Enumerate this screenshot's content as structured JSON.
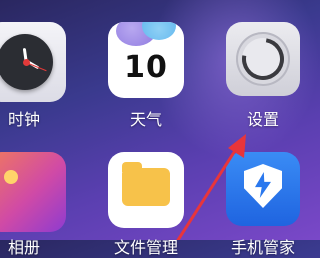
{
  "apps": [
    {
      "label": "时钟",
      "icon": "clock-icon"
    },
    {
      "label": "天气",
      "icon": "weather-icon",
      "weather_value": "10"
    },
    {
      "label": "设置",
      "icon": "settings-icon"
    },
    {
      "label": "相册",
      "icon": "photos-icon"
    },
    {
      "label": "文件管理",
      "icon": "files-icon"
    },
    {
      "label": "手机管家",
      "icon": "shield-app-icon"
    }
  ],
  "colors": {
    "arrow": "#e8353b"
  }
}
